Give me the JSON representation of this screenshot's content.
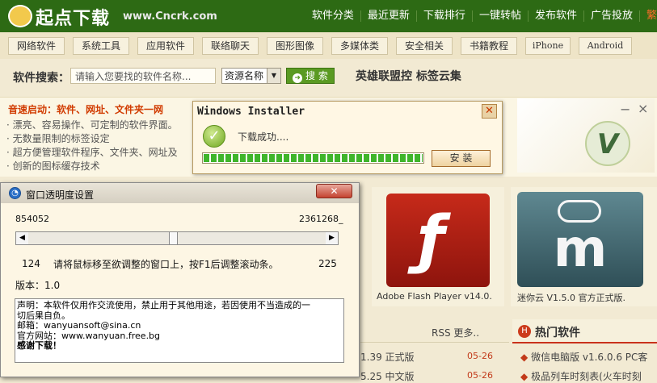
{
  "site": {
    "logo_text": "起点下载",
    "logo_url": "www.Cncrk.com",
    "topnav": [
      "软件分类",
      "最近更新",
      "下载排行",
      "一键转帖",
      "发布软件",
      "广告投放",
      "繁"
    ],
    "categories": [
      "网络软件",
      "系统工具",
      "应用软件",
      "联络聊天",
      "图形图像",
      "多媒体类",
      "安全相关",
      "书籍教程",
      "iPhone",
      "Android"
    ],
    "search": {
      "label": "软件搜索：",
      "placeholder": "请输入您要找的软件名称...",
      "select_value": "资源名称",
      "button_label": "搜 索",
      "hot_links": "英雄联盟控 标签云集"
    },
    "promo": {
      "title": "音速启动：软件、网址、文件夹一网",
      "lines": [
        "· 漂亮、容易操作、可定制的软件界面。",
        "· 无数量限制的标签设定",
        "· 超方便管理软件程序、文件夹、网址及",
        "· 创新的图标缓存技术"
      ],
      "controls": [
        "−",
        "×"
      ]
    },
    "tiles": [
      {
        "caption": "Adobe Flash Player v14.0.",
        "icon": "flash-player-icon"
      },
      {
        "caption": "迷你云 V1.5.0 官方正式版.",
        "icon": "minicloud-icon"
      }
    ],
    "list": {
      "rss": "RSS 更多..",
      "rows": [
        {
          "text": "1.39 正式版",
          "date": "05-26"
        },
        {
          "text": "5.25 中文版",
          "date": "05-26"
        }
      ]
    },
    "hot": {
      "title": "热门软件",
      "items": [
        "微信电脑版 v1.6.0.6 PC客",
        "极品列车时刻表(火车时刻"
      ]
    }
  },
  "installer": {
    "title": "Windows Installer",
    "message": "下载成功....",
    "progress_percent": 100,
    "button_label": "安 装"
  },
  "transparency": {
    "title": "窗口透明度设置",
    "left_value": "854052",
    "right_value": "2361268_",
    "scroll_min": "124",
    "scroll_max": "225",
    "hint": "请将鼠标移至欲调整的窗口上，按F1后调整滚动条。",
    "version": "版本：1.0",
    "note_lines": [
      "声明：本软件仅用作交流使用，禁止用于其他用途，若因使用不当造成的一",
      "切后果自负。",
      "邮箱：wanyuansoft@sina.cn",
      "官方网站：www.wanyuan.free.bg",
      "感谢下载！"
    ]
  }
}
